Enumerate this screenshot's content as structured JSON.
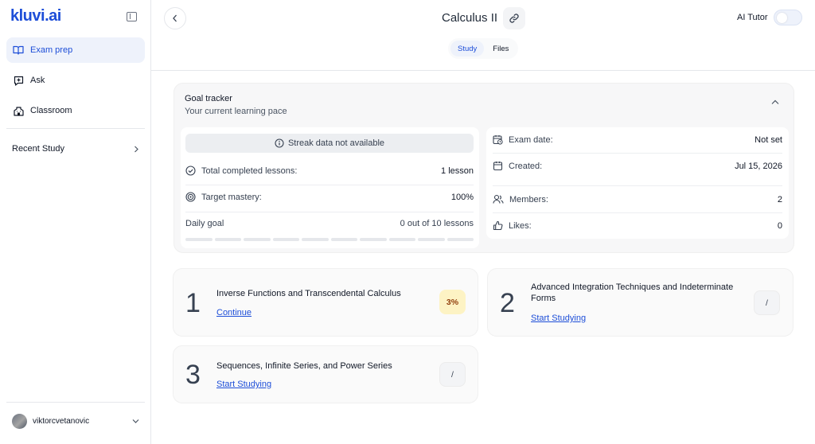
{
  "sidebar": {
    "logo": "kluvi.ai",
    "nav": [
      {
        "label": "Exam prep",
        "icon": "book-icon",
        "active": true
      },
      {
        "label": "Ask",
        "icon": "chat-plus-icon",
        "active": false
      },
      {
        "label": "Classroom",
        "icon": "building-icon",
        "active": false
      }
    ],
    "recent_label": "Recent Study",
    "user_name": "viktorcvetanovic"
  },
  "header": {
    "title": "Calculus II",
    "ai_tutor_label": "AI Tutor",
    "tabs": [
      {
        "label": "Study",
        "active": true
      },
      {
        "label": "Files",
        "active": false
      }
    ]
  },
  "goal_tracker": {
    "title": "Goal tracker",
    "subtitle": "Your current learning pace",
    "streak_message": "Streak data not available",
    "left_rows": [
      {
        "label": "Total completed lessons:",
        "value": "1 lesson",
        "icon": "check-circle-icon"
      },
      {
        "label": "Target mastery:",
        "value": "100%",
        "icon": "target-icon"
      },
      {
        "label": "Daily goal",
        "value": "0 out of 10 lessons",
        "icon": ""
      }
    ],
    "daily_goal_progress": 0,
    "daily_goal_segments": 10,
    "right_rows": [
      {
        "label": "Exam date:",
        "value": "Not set",
        "icon": "calendar-clock-icon"
      },
      {
        "label": "Created:",
        "value": "Jul 15, 2026",
        "icon": "calendar-icon"
      },
      {
        "label": "Members:",
        "value": "2",
        "icon": "users-icon"
      },
      {
        "label": "Likes:",
        "value": "0",
        "icon": "thumbs-up-icon"
      }
    ]
  },
  "lessons": [
    {
      "number": "1",
      "title": "Inverse Functions and Transcendental Calculus",
      "action": "Continue",
      "badge": "3%"
    },
    {
      "number": "2",
      "title": "Advanced Integration Techniques and Indeterminate Forms",
      "action": "Start Studying",
      "badge": "/"
    },
    {
      "number": "3",
      "title": "Sequences, Infinite Series, and Power Series",
      "action": "Start Studying",
      "badge": "/"
    }
  ],
  "colors": {
    "accent": "#1d4ed8",
    "active_bg": "#eef2fb",
    "progress_badge_bg": "#fdf3c4"
  }
}
